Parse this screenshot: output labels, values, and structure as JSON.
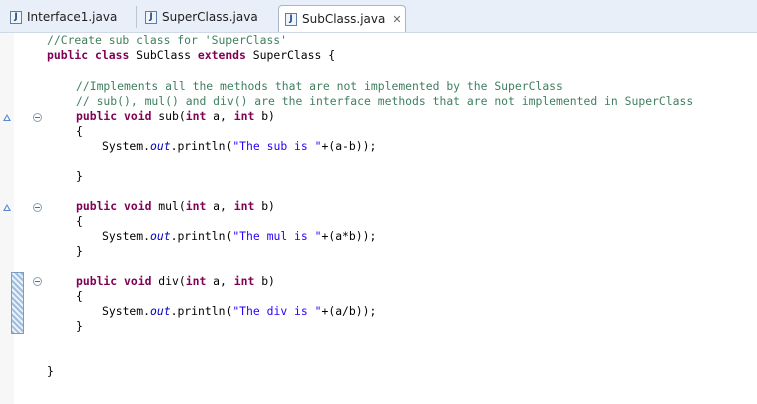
{
  "tabs": [
    {
      "label": "Interface1.java",
      "icon": "java-file-icon",
      "active": false
    },
    {
      "label": "SuperClass.java",
      "icon": "java-file-icon",
      "active": false
    },
    {
      "label": "SubClass.java",
      "icon": "java-file-icon",
      "active": true,
      "close": "✕"
    }
  ],
  "code": {
    "l1": "//Create sub class for 'SuperClass'",
    "l2_public": "public",
    "l2_class": "class",
    "l2_name": " SubClass ",
    "l2_extends": "extends",
    "l2_rest": " SuperClass {",
    "l4": "//Implements all the methods that are not implemented by the SuperClass",
    "l5": "// sub(), mul() and div() are the interface methods that are not implemented in SuperClass",
    "kw_public": "public",
    "kw_void": "void",
    "kw_int": "int",
    "sub_name": " sub(",
    "mul_name": " mul(",
    "div_name": " div(",
    "args_a": " a, ",
    "args_b": " b)",
    "open_brace": "{",
    "close_brace": "}",
    "sys": "System.",
    "out": "out",
    "println": ".println(",
    "str_sub": "\"The sub is \"",
    "str_mul": "\"The mul is \"",
    "str_div": "\"The div is \"",
    "expr_sub": "+(a-b));",
    "expr_mul": "+(a*b));",
    "expr_div": "+(a/b));",
    "final_brace": "}"
  },
  "colors": {
    "comment": "#3f7f5f",
    "keyword": "#7f0055",
    "string": "#2a00ff",
    "field": "#0000c0"
  }
}
